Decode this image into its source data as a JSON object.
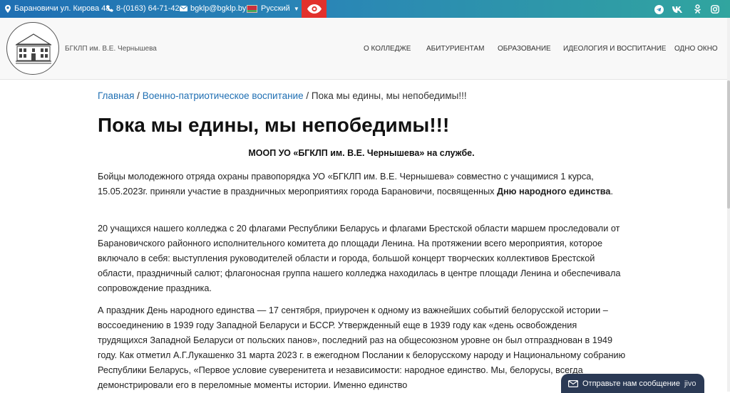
{
  "topbar": {
    "address": "Барановичи ул. Кирова 48",
    "phone": "8-(0163) 64-71-42",
    "email": "bgklp@bgklp.by",
    "language": "Русский",
    "colors": {
      "gradient_start": "#1f6fb3",
      "gradient_end": "#31a59f",
      "accessibility": "#e2312c"
    },
    "social_icons": [
      "telegram-icon",
      "vk-icon",
      "odnoklassniki-icon",
      "instagram-icon"
    ]
  },
  "header": {
    "brand": "БГКЛП им. В.Е. Чернышева",
    "nav": [
      "О КОЛЛЕДЖЕ",
      "АБИТУРИЕНТАМ",
      "ОБРАЗОВАНИЕ",
      "ИДЕОЛОГИЯ И ВОСПИТАНИЕ",
      "ОДНО ОКНО"
    ]
  },
  "breadcrumb": {
    "home": "Главная",
    "sep": "/",
    "section": "Военно-патриотическое воспитание",
    "current": "Пока мы едины, мы непобедимы!!!"
  },
  "article": {
    "title": "Пока мы едины, мы непобедимы!!!",
    "subtitle": "МООП УО «БГКЛП им. В.Е. Чернышева» на службе.",
    "p1_text": "Бойцы молодежного отряда охраны правопорядка УО «БГКЛП им. В.Е. Чернышева» совместно с учащимися 1 курса, 15.05.2023г. приняли участие в праздничных мероприятиях города Барановичи, посвященных ",
    "p1_bold": "Дню народного единства",
    "p1_end": ".",
    "p2": "20 учащихся нашего колледжа с 20 флагами Республики Беларусь и флагами Брестской области маршем проследовали от Барановичского районного исполнительного комитета до  площади Ленина. На протяжении всего мероприятия, которое включало в себя: выступления руководителей области и города, большой концерт творческих коллективов Брестской области, праздничный салют; флагоносная группа нашего колледжа находилась в центре площади Ленина и обеспечивала сопровождение праздника.",
    "p3": "А праздник День народного единства — 17 сентября, приурочен к одному из важнейших событий белорусской истории – воссоединению в 1939 году Западной Беларуси и БССР. Утвержденный еще в 1939 году как «день освобождения трудящихся Западной Беларуси от польских панов», последний раз на общесоюзном уровне он был отпразднован в 1949 году. Как отметил А.Г.Лукашенко 31 марта 2023 г. в ежегодном Послании к белорусскому народу и Национальному собранию Республики Беларусь, «Первое условие суверенитета и независимости: народное единство. Мы, белорусы, всегда демонстрировали его в переломные моменты истории. Именно единство"
  },
  "chat": {
    "label": "Отправьте нам сообщение",
    "brand": "jivo",
    "color": "#2b3a55"
  }
}
